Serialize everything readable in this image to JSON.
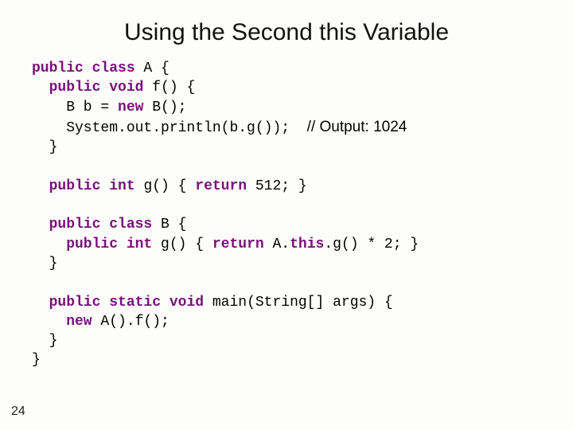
{
  "title": "Using the Second this Variable",
  "page_number": "24",
  "code": {
    "l1a": "public",
    "l1b": " class",
    "l1c": " A {",
    "l2a": "  public",
    "l2b": " void",
    "l2c": " f() {",
    "l3a": "    B b = ",
    "l3b": "new",
    "l3c": " B();",
    "l4a": "    System.out.println(b.g());  ",
    "l4b": "// Output: 1024",
    "l5": "  }",
    "l7a": "  public",
    "l7b": " int",
    "l7c": " g() { ",
    "l7d": "return",
    "l7e": " 512; }",
    "l9a": "  public",
    "l9b": " class",
    "l9c": " B {",
    "l10a": "    public",
    "l10b": " int",
    "l10c": " g() { ",
    "l10d": "return",
    "l10e": " A.",
    "l10f": "this",
    "l10g": ".g() * 2; }",
    "l11": "  }",
    "l13a": "  public",
    "l13b": " static",
    "l13c": " void",
    "l13d": " main(String[] args) {",
    "l14a": "    new",
    "l14b": " A().f();",
    "l15": "  }",
    "l16": "}"
  }
}
